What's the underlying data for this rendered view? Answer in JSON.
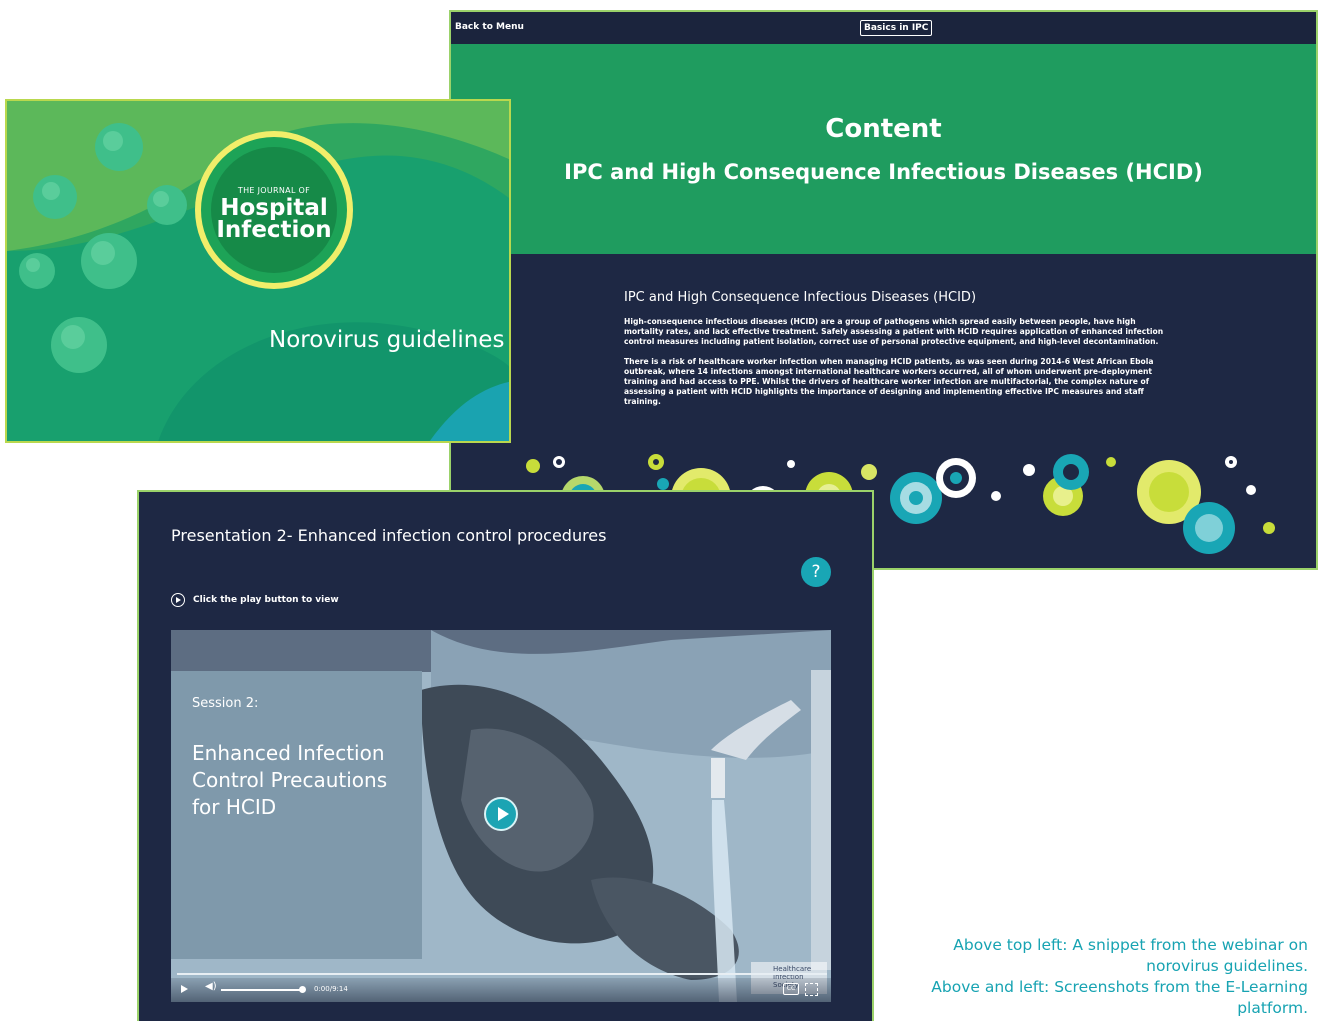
{
  "content_page": {
    "back_link": "Back to Menu",
    "topic_button": "Basics in IPC",
    "banner_title": "Content",
    "banner_subtitle": "IPC and High Consequence Infectious Diseases (HCID)",
    "section_heading": "IPC and High Consequence Infectious Diseases (HCID)",
    "paragraph_1": "High-consequence infectious diseases (HCID) are a group of pathogens which spread easily between people, have high mortality rates, and lack effective treatment. Safely assessing a patient with HCID requires application of enhanced infection control measures including patient isolation, correct use of personal protective equipment, and high-level decontamination.",
    "paragraph_2": "There is a risk of healthcare worker infection when managing HCID patients, as was seen during 2014-6 West African Ebola outbreak, where 14 infections amongst international healthcare workers occurred, all of whom underwent pre-deployment training and had access to PPE. Whilst the drivers of healthcare worker infection are multifactorial, the complex nature of assessing a patient with HCID highlights the importance of designing and implementing effective IPC measures and staff training."
  },
  "webinar_slide": {
    "journal_small": "THE JOURNAL OF",
    "journal_line1": "Hospital",
    "journal_line2": "Infection",
    "title": "Norovirus guidelines"
  },
  "presentation": {
    "title": "Presentation 2-  Enhanced infection control procedures",
    "help_label": "?",
    "instruction": "Click the play button to view",
    "session_label": "Session 2:",
    "session_title": "Enhanced Infection Control Precautions for HCID",
    "time": "0:00/9:14",
    "cc_label": "CC",
    "society_logo_text": "Healthcare Infection Society"
  },
  "caption": {
    "line1": "Above top left: A snippet from the webinar on norovirus guidelines.",
    "line2": "Above and left: Screenshots from the E-Learning platform."
  },
  "colors": {
    "navy": "#1e2844",
    "green": "#1f9c5f",
    "teal": "#19a6b5",
    "lime": "#c8dd3a",
    "caption": "#17a3b2"
  }
}
